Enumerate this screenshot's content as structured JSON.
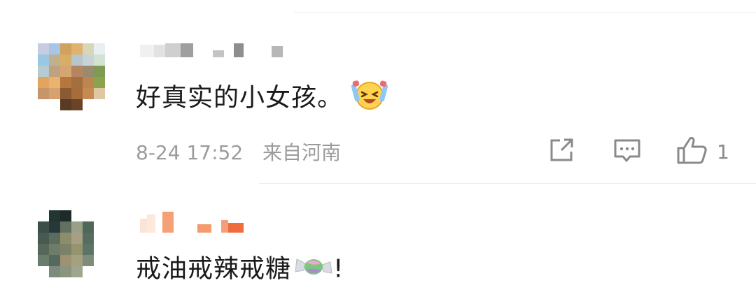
{
  "comments": [
    {
      "text": "好真实的小女孩。",
      "emoji": "laughing-crying-emoji",
      "date": "8-24 17:52",
      "location": "来自河南",
      "likes": "1",
      "avatar_colors": [
        "#c6cde0",
        "#a7c5e6",
        "#d1a25e",
        "#e0b26b",
        "#d9d6b8",
        "#e9eef2",
        "#ffffff",
        "#98c8e4",
        "#c0b090",
        "#d7ae66",
        "#b6c6cc",
        "#c9d3d5",
        "#d4e3cf",
        "#ffffff",
        "#b7ccd2",
        "#bfa27f",
        "#d6a574",
        "#b4855e",
        "#9b8a70",
        "#7f9a55",
        "#ffffff",
        "#e3a45f",
        "#e7b36d",
        "#b5773e",
        "#a2703f",
        "#bb8650",
        "#8da24c",
        "#ffffff",
        "#c5956c",
        "#d6a16f",
        "#8a5a34",
        "#a66d3c",
        "#c68a52",
        "#e0c7a4",
        "#ffffff",
        "#ffffff",
        "#ffffff",
        "#5a3a22",
        "#6b4328",
        "#ffffff",
        "#ffffff",
        "#ffffff",
        "#ffffff",
        "#ffffff",
        "#ffffff",
        "#ffffff",
        "#ffffff",
        "#ffffff",
        "#ffffff"
      ]
    },
    {
      "text": "戒油戒辣戒糖",
      "emoji": "candy-emoji",
      "suffix": "!",
      "avatar_colors": [
        "#ffffff",
        "#233530",
        "#1c2a28",
        "#ffffff",
        "#ffffff",
        "#ffffff",
        "#ffffff",
        "#3a4f47",
        "#27373a",
        "#62705f",
        "#9aa087",
        "#4f6759",
        "#ffffff",
        "#ffffff",
        "#485a4f",
        "#5d6b5d",
        "#8d8d6c",
        "#a5a083",
        "#566c60",
        "#ffffff",
        "#ffffff",
        "#546759",
        "#6f7c67",
        "#7c8267",
        "#96946f",
        "#5c7466",
        "#ffffff",
        "#ffffff",
        "#6a7d6c",
        "#55695c",
        "#9d9271",
        "#a4a17f",
        "#7d8d79",
        "#ffffff",
        "#ffffff",
        "#ffffff",
        "#7b8c7e",
        "#89957f",
        "#a0a58f",
        "#ffffff",
        "#ffffff",
        "#ffffff",
        "#ffffff",
        "#ffffff",
        "#ffffff",
        "#ffffff",
        "#ffffff",
        "#ffffff",
        "#ffffff"
      ]
    }
  ]
}
